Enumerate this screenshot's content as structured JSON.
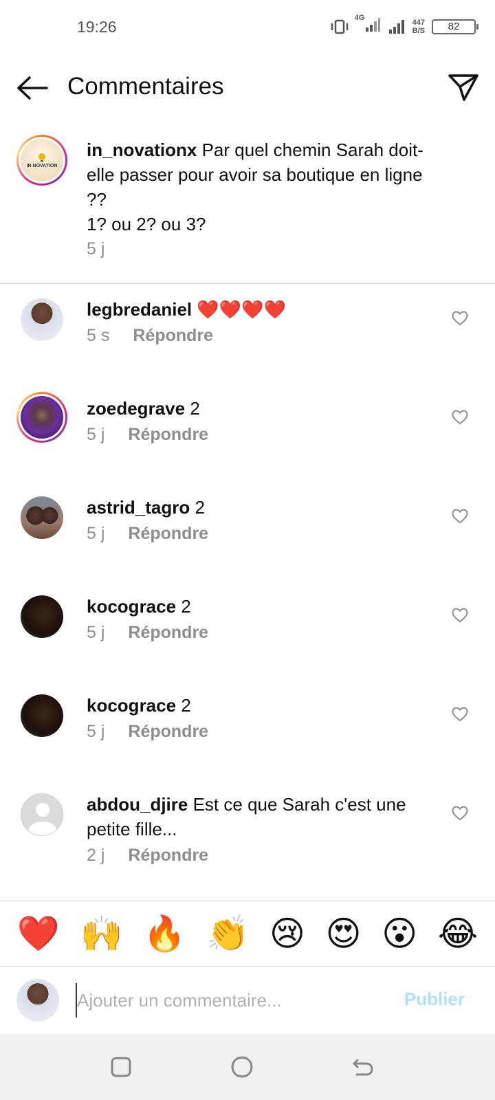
{
  "status_bar": {
    "time": "19:26",
    "network_label": "4G",
    "speed_value": "447",
    "speed_unit": "B/S",
    "battery": "82"
  },
  "header": {
    "title": "Commentaires"
  },
  "caption": {
    "username": "in_novationx",
    "text": "Par quel chemin Sarah doit-elle passer pour avoir sa boutique en ligne ??",
    "text2": "1? ou 2? ou 3?",
    "time": "5 j",
    "avatar_logo_text": "IN NOVATION"
  },
  "comments": [
    {
      "username": "legbredaniel",
      "text": "❤️❤️❤️❤️",
      "time": "5 s",
      "reply": "Répondre"
    },
    {
      "username": "zoedegrave",
      "text": "2",
      "time": "5 j",
      "reply": "Répondre"
    },
    {
      "username": "astrid_tagro",
      "text": "2",
      "time": "5 j",
      "reply": "Répondre"
    },
    {
      "username": "kocograce",
      "text": "2",
      "time": "5 j",
      "reply": "Répondre"
    },
    {
      "username": "kocograce",
      "text": "2",
      "time": "5 j",
      "reply": "Répondre"
    },
    {
      "username": "abdou_djire",
      "text": "Est ce que Sarah c'est une petite fille...",
      "time": "2 j",
      "reply": "Répondre"
    }
  ],
  "emoji_bar": [
    "❤️",
    "🙌",
    "🔥",
    "👏",
    "😢",
    "😍",
    "😮",
    "😂"
  ],
  "composer": {
    "placeholder": "Ajouter un commentaire...",
    "publish_label": "Publier"
  },
  "colors": {
    "accent": "#0095f6",
    "publish_disabled": "#b2dffc",
    "meta_text": "#8e8e8e"
  }
}
